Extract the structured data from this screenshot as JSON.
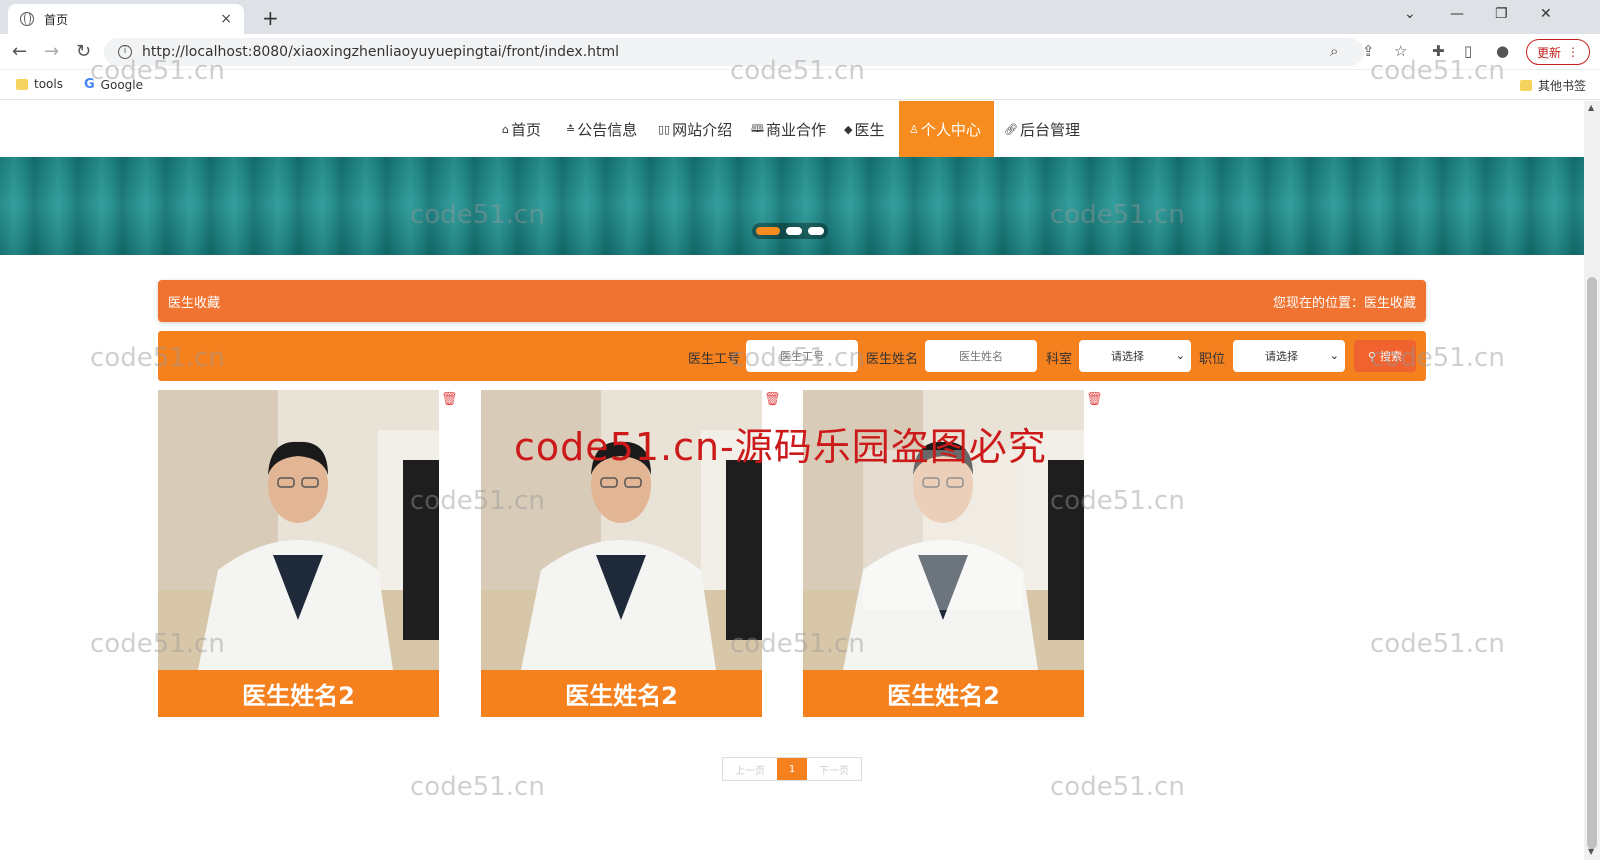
{
  "browser": {
    "tab_title": "首页",
    "tab_close": "×",
    "new_tab": "+",
    "url": "http://localhost:8080/xiaoxingzhenliaoyuyuepingtai/front/index.html",
    "update_label": "更新",
    "bookmarks": {
      "tools": "tools",
      "google": "Google",
      "other": "其他书签"
    }
  },
  "nav": {
    "items": [
      {
        "label": "首页",
        "icon": "home-icon"
      },
      {
        "label": "公告信息",
        "icon": "list-icon"
      },
      {
        "label": "网站介绍",
        "icon": "columns-icon"
      },
      {
        "label": "商业合作",
        "icon": "book-icon"
      },
      {
        "label": "医生",
        "icon": "graduation-cap-icon"
      },
      {
        "label": "个人中心",
        "icon": "user-icon"
      },
      {
        "label": "后台管理",
        "icon": "link-icon"
      }
    ],
    "active": "个人中心"
  },
  "page": {
    "title": "医生收藏",
    "location_label": "您现在的位置：",
    "location_value": "医生收藏"
  },
  "search": {
    "doctor_id_label": "医生工号",
    "doctor_id_placeholder": "医生工号",
    "doctor_name_label": "医生姓名",
    "doctor_name_placeholder": "医生姓名",
    "department_label": "科室",
    "department_selected": "请选择",
    "position_label": "职位",
    "position_selected": "请选择",
    "search_button": "搜索"
  },
  "cards": [
    {
      "name": "医生姓名2"
    },
    {
      "name": "医生姓名2"
    },
    {
      "name": "医生姓名2"
    }
  ],
  "pager": {
    "prev": "上一页",
    "current": "1",
    "next": "下一页"
  },
  "watermarks": {
    "text": "code51.cn",
    "red": "code51.cn-源码乐园盗图必究"
  },
  "colors": {
    "accent": "#f5801e",
    "title_bar": "#f07332",
    "banner": "#1c8686",
    "delete": "#e04a4a"
  }
}
